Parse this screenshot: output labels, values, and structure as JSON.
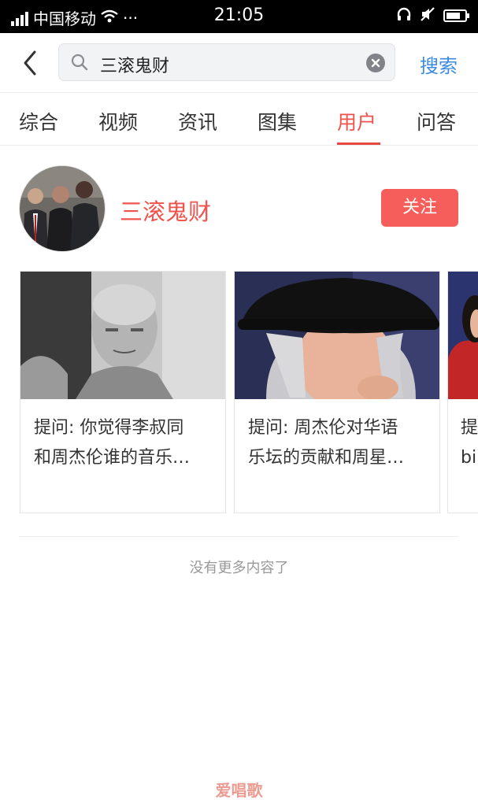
{
  "status_bar": {
    "carrier": "中国移动",
    "dots": "···",
    "time": "21:05",
    "battery_level": 0.75
  },
  "search": {
    "query": "三滚鬼财",
    "submit_label": "搜索"
  },
  "tabs": [
    {
      "label": "综合",
      "active": false
    },
    {
      "label": "视频",
      "active": false
    },
    {
      "label": "资讯",
      "active": false
    },
    {
      "label": "图集",
      "active": false
    },
    {
      "label": "用户",
      "active": true
    },
    {
      "label": "问答",
      "active": false
    }
  ],
  "user": {
    "name": "三滚鬼财",
    "follow_label": "关注"
  },
  "cards": [
    {
      "line1": "提问: 你觉得李叔同",
      "line2": "和周杰伦谁的音乐…"
    },
    {
      "line1": "提问: 周杰伦对华语",
      "line2": "乐坛的贡献和周星…"
    },
    {
      "line1": "提",
      "line2": "bi"
    }
  ],
  "footer": {
    "no_more": "没有更多内容了"
  },
  "watermark": "爱唱歌",
  "colors": {
    "accent": "#f0524c",
    "follow_button": "#f55e5a",
    "search_button": "#3b8ae0"
  }
}
